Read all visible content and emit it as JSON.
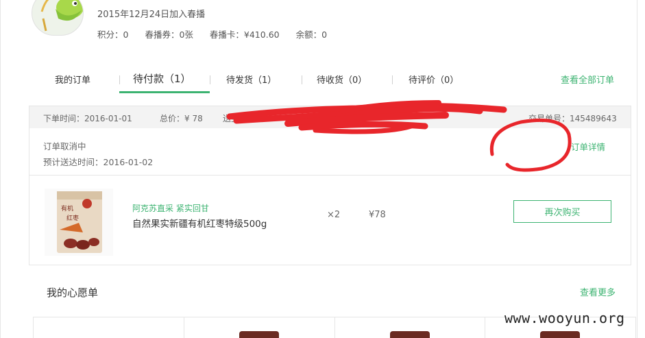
{
  "profile": {
    "join_text": "2015年12月24日加入春播",
    "points": "积分：0",
    "coupons": "春播券：0张",
    "card": "春播卡：¥410.60",
    "balance": "余额：0"
  },
  "tabs": {
    "items": [
      {
        "label": "我的订单"
      },
      {
        "label": "待付款（1）"
      },
      {
        "label": "待发货（1）"
      },
      {
        "label": "待收货（0）"
      },
      {
        "label": "待评价（0）"
      }
    ],
    "active": "待付款（1）",
    "view_all": "查看全部订单"
  },
  "order": {
    "order_time": "下单时间：2016-01-01",
    "total": "总价：¥ 78",
    "ship_to": "送至：",
    "order_no": "交易单号：145489643",
    "status": "订单取消中",
    "eta": "预计送达时间：2016-01-02",
    "detail_link": "订单详情",
    "product": {
      "promo": "阿克苏直采 紧实回甘",
      "name": "自然果实新疆有机红枣特级500g",
      "qty": "×2",
      "price": "¥78",
      "package_text": "有机红枣"
    },
    "rebuy": "再次购买"
  },
  "wishlist": {
    "title": "我的心愿单",
    "more": "查看更多"
  },
  "watermark": "www.wooyun.org",
  "colors": {
    "accent": "#3cb371",
    "redaction": "#e8262b"
  }
}
